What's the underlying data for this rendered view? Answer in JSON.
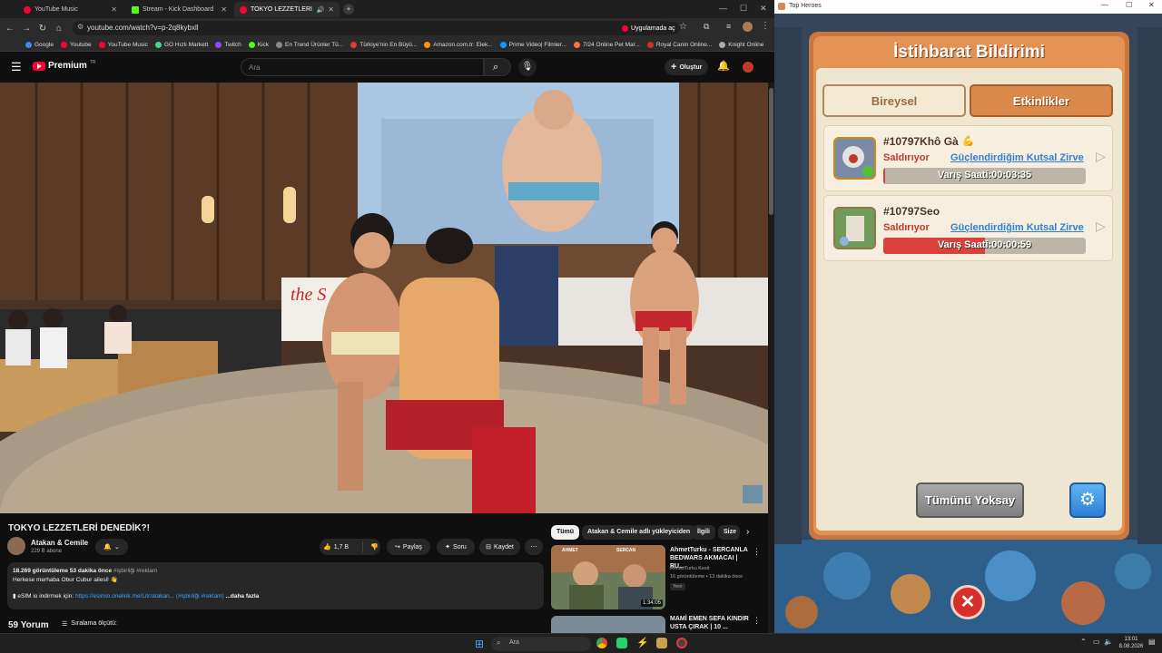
{
  "browser": {
    "tabs": [
      {
        "label": "YouTube Music",
        "color": "#ff0033"
      },
      {
        "label": "Stream - Kick Dashboard",
        "color": "#53fc18"
      },
      {
        "label": "TOKYO LEZZETLERİ DENEDİ",
        "color": "#ff0033"
      }
    ],
    "url": "youtube.com/watch?v=p-2q8kybxll",
    "app_button": "Uygulamada aç",
    "bookmarks": [
      "Google",
      "Youtube",
      "YouTube Music",
      "GO Hızlı Markett",
      "Twitch",
      "Kick",
      "En Trend Ürünler Tü...",
      "Türkiye'nin En Büyü...",
      "Amazon.com.tr: Elek...",
      "Prime Video| Filmler...",
      "7/24 Online Pet Mar...",
      "Royal Canin Online...",
      "Knight Online"
    ],
    "bookmark_colors": [
      "#4285f4",
      "#ff0033",
      "#ff0033",
      "#3ddc84",
      "#9146ff",
      "#53fc18",
      "#888",
      "#e53935",
      "#ff9900",
      "#1399ff",
      "#ff7043",
      "#d32f2f",
      "#aaa"
    ]
  },
  "youtube": {
    "logo": "Premium",
    "logo_badge": "TR",
    "search_placeholder": "Ara",
    "create_label": "Oluştur",
    "video_title": "TOKYO LEZZETLERİ DENEDİK?!",
    "channel_name": "Atakan & Cemile",
    "subscribers": "229 B abone",
    "likes": "1,7 B",
    "share": "Paylaş",
    "ask": "Soru",
    "save": "Kaydet",
    "views_line": "18.269 görüntüleme  53 dakika önce",
    "hashtags_top": "#işbirliği #reklam",
    "desc_line1": "Herkese merhaba Obur Cubur ailesi! 👋",
    "desc_line2_prefix": "eSIM io indirmek için:",
    "desc_link": "https://esimio.onelink.me/Litr/atakan...",
    "desc_line2_tags": "(#işbirliği #reklam)",
    "desc_more": "...daha fazla",
    "comments_count": "59 Yorum",
    "sort_label": "Sıralama ölçütü:",
    "chips": [
      "Tümü",
      "Atakan & Cemile adlı yükleyiciden",
      "İlgili",
      "Size"
    ],
    "recommended": [
      {
        "title": "AhmetTurku - SERCANLA BEDWARS AKMACAI | RU...",
        "channel": "AhmetTurku Kesit",
        "meta": "16 görüntüleme • 13 dakika önce",
        "badge": "Yeni",
        "duration": "1:34:05"
      },
      {
        "title": "MAMİ EMEN SEFA KINDIR USTA ÇIRAK | 10 ...",
        "channel": "",
        "meta": "",
        "badge": "",
        "duration": ""
      }
    ],
    "thumb_labels": [
      "AHMET",
      "SERCAN"
    ]
  },
  "game": {
    "window_title": "Top Heroes",
    "panel_title": "İstihbarat Bildirimi",
    "tabs": [
      "Bireysel",
      "Etkinlikler"
    ],
    "reports": [
      {
        "id": "#10797Khô Gà",
        "status": "Saldırıyor",
        "target": "Güçlendirdiğim Kutsal Zirve",
        "eta_label": "Varış Saati:00:03:35",
        "progress": 0.01
      },
      {
        "id": "#10797Seo",
        "status": "Saldırıyor",
        "target": "Güçlendirdiğim Kutsal Zirve",
        "eta_label": "Varış Saati:00:00:59",
        "progress": 0.5
      }
    ],
    "ignore_all": "Tümünü Yoksay",
    "colors": {
      "active_tab": "#d98a4a",
      "status_red": "#c0392b",
      "link_blue": "#2f7fd6"
    }
  },
  "taskbar": {
    "search_placeholder": "Ara",
    "time": "13:01",
    "date": "8.08.2026"
  }
}
